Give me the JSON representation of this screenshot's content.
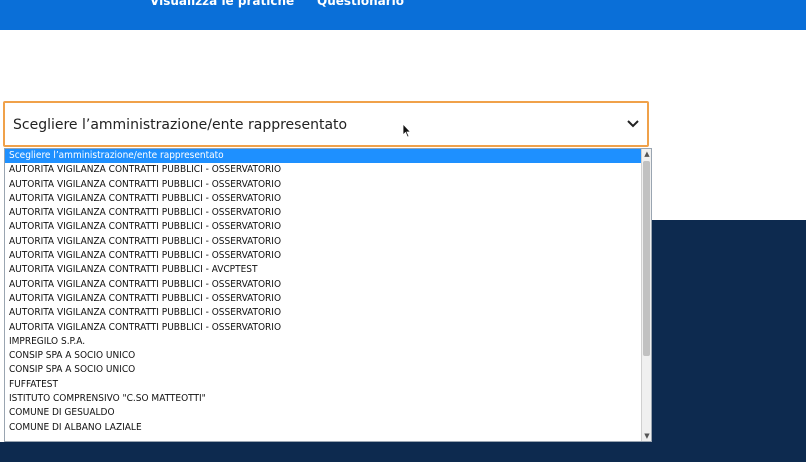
{
  "header": {
    "nav": [
      {
        "label": "Visualizza le pratiche"
      },
      {
        "label": "Questionario"
      }
    ]
  },
  "select": {
    "value": "Scegliere l’amministrazione/ente rappresentato",
    "icon": "chevron-down-icon"
  },
  "dropdown": {
    "options": [
      {
        "label": "Scegliere l’amministrazione/ente rappresentato",
        "selected": true
      },
      {
        "label": "AUTORITA VIGILANZA CONTRATTI PUBBLICI - OSSERVATORIO"
      },
      {
        "label": "AUTORITA VIGILANZA CONTRATTI PUBBLICI - OSSERVATORIO"
      },
      {
        "label": "AUTORITA VIGILANZA CONTRATTI PUBBLICI - OSSERVATORIO"
      },
      {
        "label": "AUTORITA VIGILANZA CONTRATTI PUBBLICI - OSSERVATORIO"
      },
      {
        "label": "AUTORITA VIGILANZA CONTRATTI PUBBLICI - OSSERVATORIO"
      },
      {
        "label": "AUTORITA VIGILANZA CONTRATTI PUBBLICI - OSSERVATORIO"
      },
      {
        "label": "AUTORITA VIGILANZA CONTRATTI PUBBLICI - OSSERVATORIO"
      },
      {
        "label": "AUTORITA VIGILANZA CONTRATTI PUBBLICI - AVCPTEST"
      },
      {
        "label": "AUTORITA VIGILANZA CONTRATTI PUBBLICI - OSSERVATORIO"
      },
      {
        "label": "AUTORITA VIGILANZA CONTRATTI PUBBLICI - OSSERVATORIO"
      },
      {
        "label": "AUTORITA VIGILANZA CONTRATTI PUBBLICI - OSSERVATORIO"
      },
      {
        "label": "AUTORITA VIGILANZA CONTRATTI PUBBLICI - OSSERVATORIO"
      },
      {
        "label": "IMPREGILO S.P.A."
      },
      {
        "label": "CONSIP SPA A SOCIO UNICO"
      },
      {
        "label": "CONSIP SPA A SOCIO UNICO"
      },
      {
        "label": "FUFFATEST"
      },
      {
        "label": "ISTITUTO COMPRENSIVO \"C.SO MATTEOTTI\""
      },
      {
        "label": "COMUNE DI GESUALDO"
      },
      {
        "label": "COMUNE DI ALBANO LAZIALE"
      }
    ]
  },
  "colors": {
    "header_blue": "#0a6fd8",
    "select_focus_border": "#f0a14a",
    "selected_option": "#1e90ff",
    "dark_background": "#0d2a4f"
  }
}
